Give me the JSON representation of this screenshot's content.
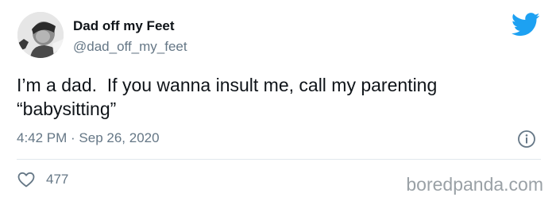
{
  "author": {
    "display_name": "Dad off my Feet",
    "handle": "@dad_off_my_feet"
  },
  "tweet": {
    "text": "I’m a dad.  If you wanna insult me, call my parenting\n“babysitting”",
    "timestamp": "4:42 PM · Sep 26, 2020",
    "likes": "477"
  },
  "watermark": "boredpanda.com",
  "colors": {
    "twitter_blue": "#1DA1F2",
    "secondary_text": "#657786",
    "primary_text": "#0f1419",
    "divider": "#e1e8ed"
  },
  "icons": {
    "brand": "twitter-bird-icon",
    "info": "info-icon",
    "like": "heart-icon"
  }
}
